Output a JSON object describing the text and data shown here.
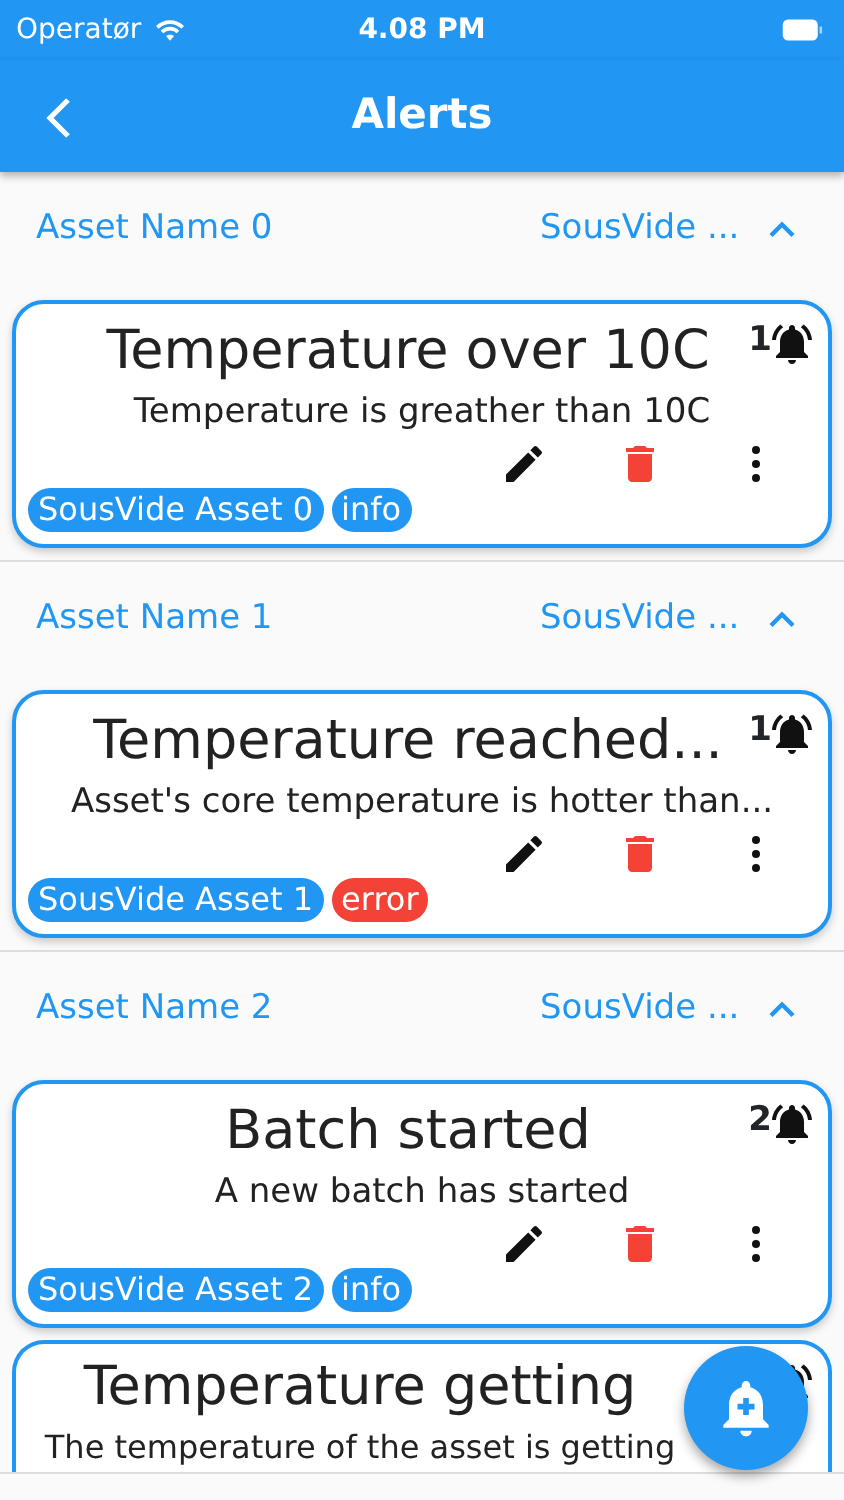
{
  "status_bar": {
    "carrier": "Operatør",
    "time": "4.08 PM"
  },
  "app_bar": {
    "title": "Alerts"
  },
  "groups": [
    {
      "asset_name": "Asset Name 0",
      "asset_type": "SousVide ...",
      "expanded": true,
      "alerts": [
        {
          "title": "Temperature over 10C",
          "count": "1",
          "description": "Temperature is greather than 10C",
          "tags": [
            {
              "label": "SousVide Asset 0",
              "color": "#2196f3"
            },
            {
              "label": "info",
              "color": "#2196f3"
            }
          ]
        }
      ]
    },
    {
      "asset_name": "Asset Name 1",
      "asset_type": "SousVide ...",
      "expanded": true,
      "alerts": [
        {
          "title": "Temperature reached...",
          "count": "1",
          "description": "Asset's core temperature is hotter than...",
          "tags": [
            {
              "label": "SousVide Asset 1",
              "color": "#2196f3"
            },
            {
              "label": "error",
              "color": "#f44336"
            }
          ]
        }
      ]
    },
    {
      "asset_name": "Asset Name 2",
      "asset_type": "SousVide ...",
      "expanded": true,
      "alerts": [
        {
          "title": "Batch started",
          "count": "2",
          "description": "A new batch has started",
          "tags": [
            {
              "label": "SousVide Asset 2",
              "color": "#2196f3"
            },
            {
              "label": "info",
              "color": "#2196f3"
            }
          ]
        },
        {
          "title": "Temperature getting",
          "description": "The temperature of the asset is getting"
        }
      ]
    }
  ]
}
